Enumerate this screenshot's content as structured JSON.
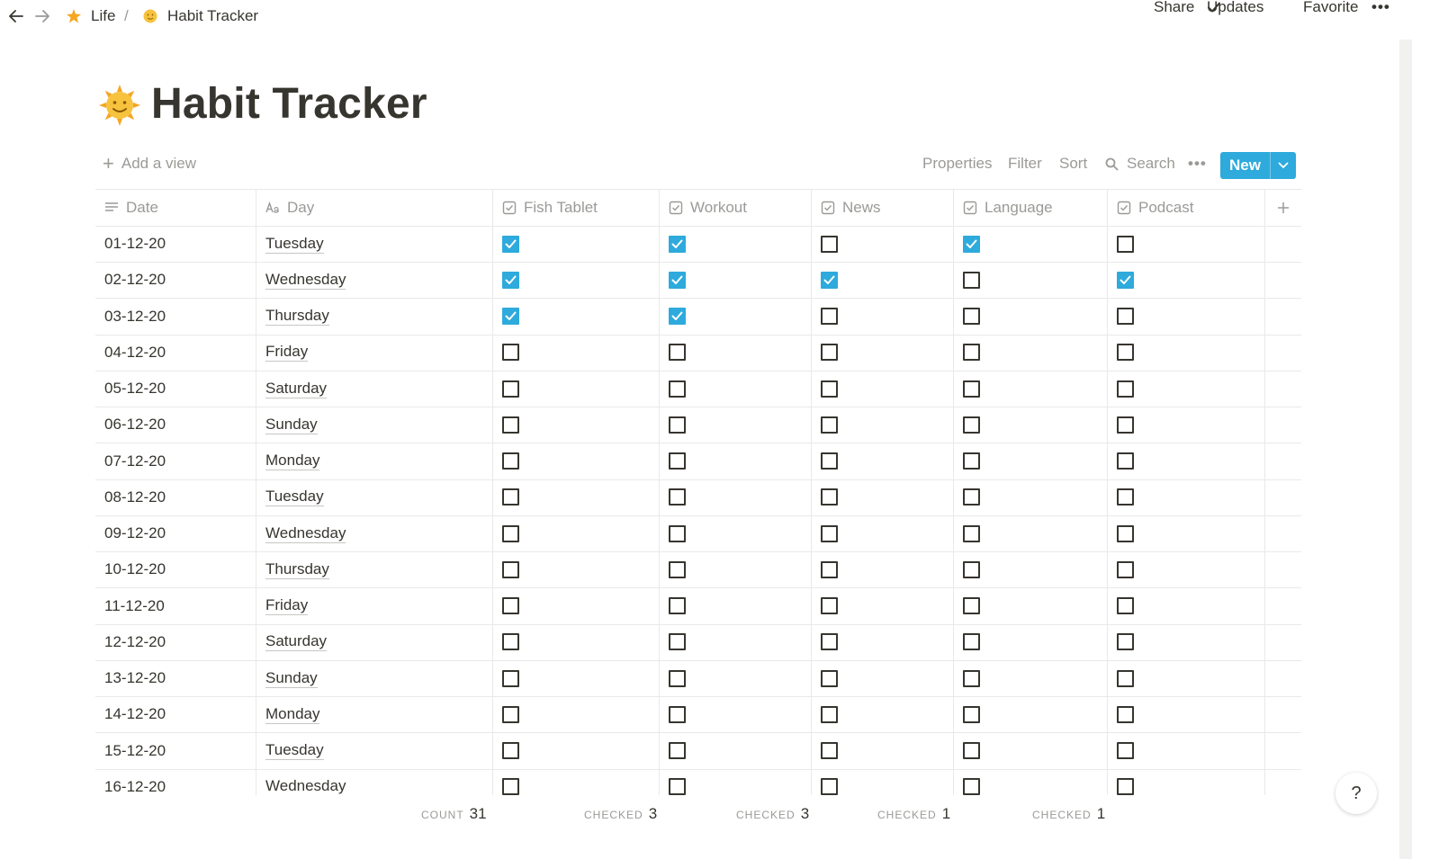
{
  "breadcrumb": {
    "items": [
      {
        "label": "Life",
        "icon": "sparkle-icon"
      },
      {
        "label": "Habit Tracker",
        "icon": "sun-face-icon"
      }
    ],
    "separator": "/"
  },
  "top_actions": {
    "share": "Share",
    "updates": "Updates",
    "favorite": "Favorite",
    "more": "•••"
  },
  "page": {
    "icon": "sun-face-icon",
    "title": "Habit Tracker"
  },
  "toolbar": {
    "add_view": "Add a view",
    "properties": "Properties",
    "filter": "Filter",
    "sort": "Sort",
    "search": "Search",
    "more": "•••",
    "new": "New"
  },
  "columns": [
    {
      "key": "date",
      "label": "Date",
      "icon": "text-lines-icon"
    },
    {
      "key": "day",
      "label": "Day",
      "icon": "title-aa-icon"
    },
    {
      "key": "fish",
      "label": "Fish Tablet",
      "icon": "checkbox-icon"
    },
    {
      "key": "work",
      "label": "Workout",
      "icon": "checkbox-icon"
    },
    {
      "key": "news",
      "label": "News",
      "icon": "checkbox-icon"
    },
    {
      "key": "lang",
      "label": "Language",
      "icon": "checkbox-icon"
    },
    {
      "key": "pod",
      "label": "Podcast",
      "icon": "checkbox-icon"
    }
  ],
  "rows": [
    {
      "date": "01-12-20",
      "day": "Tuesday",
      "fish": true,
      "work": true,
      "news": false,
      "lang": true,
      "pod": false
    },
    {
      "date": "02-12-20",
      "day": "Wednesday",
      "fish": true,
      "work": true,
      "news": true,
      "lang": false,
      "pod": true
    },
    {
      "date": "03-12-20",
      "day": "Thursday",
      "fish": true,
      "work": true,
      "news": false,
      "lang": false,
      "pod": false
    },
    {
      "date": "04-12-20",
      "day": "Friday",
      "fish": false,
      "work": false,
      "news": false,
      "lang": false,
      "pod": false
    },
    {
      "date": "05-12-20",
      "day": "Saturday",
      "fish": false,
      "work": false,
      "news": false,
      "lang": false,
      "pod": false
    },
    {
      "date": "06-12-20",
      "day": "Sunday",
      "fish": false,
      "work": false,
      "news": false,
      "lang": false,
      "pod": false
    },
    {
      "date": "07-12-20",
      "day": "Monday",
      "fish": false,
      "work": false,
      "news": false,
      "lang": false,
      "pod": false
    },
    {
      "date": "08-12-20",
      "day": "Tuesday",
      "fish": false,
      "work": false,
      "news": false,
      "lang": false,
      "pod": false
    },
    {
      "date": "09-12-20",
      "day": "Wednesday",
      "fish": false,
      "work": false,
      "news": false,
      "lang": false,
      "pod": false
    },
    {
      "date": "10-12-20",
      "day": "Thursday",
      "fish": false,
      "work": false,
      "news": false,
      "lang": false,
      "pod": false
    },
    {
      "date": "11-12-20",
      "day": "Friday",
      "fish": false,
      "work": false,
      "news": false,
      "lang": false,
      "pod": false
    },
    {
      "date": "12-12-20",
      "day": "Saturday",
      "fish": false,
      "work": false,
      "news": false,
      "lang": false,
      "pod": false
    },
    {
      "date": "13-12-20",
      "day": "Sunday",
      "fish": false,
      "work": false,
      "news": false,
      "lang": false,
      "pod": false
    },
    {
      "date": "14-12-20",
      "day": "Monday",
      "fish": false,
      "work": false,
      "news": false,
      "lang": false,
      "pod": false
    },
    {
      "date": "15-12-20",
      "day": "Tuesday",
      "fish": false,
      "work": false,
      "news": false,
      "lang": false,
      "pod": false
    },
    {
      "date": "16-12-20",
      "day": "Wednesday",
      "fish": false,
      "work": false,
      "news": false,
      "lang": false,
      "pod": false
    }
  ],
  "aggregates": [
    {
      "label": "COUNT",
      "value": "31"
    },
    {
      "label": "CHECKED",
      "value": "3"
    },
    {
      "label": "CHECKED",
      "value": "3"
    },
    {
      "label": "CHECKED",
      "value": "1"
    },
    {
      "label": "CHECKED",
      "value": "1"
    }
  ],
  "help": "?",
  "colors": {
    "accent": "#2eaadc",
    "text": "#37352f",
    "muted": "#9b9a97",
    "border": "#e9e9e7"
  }
}
